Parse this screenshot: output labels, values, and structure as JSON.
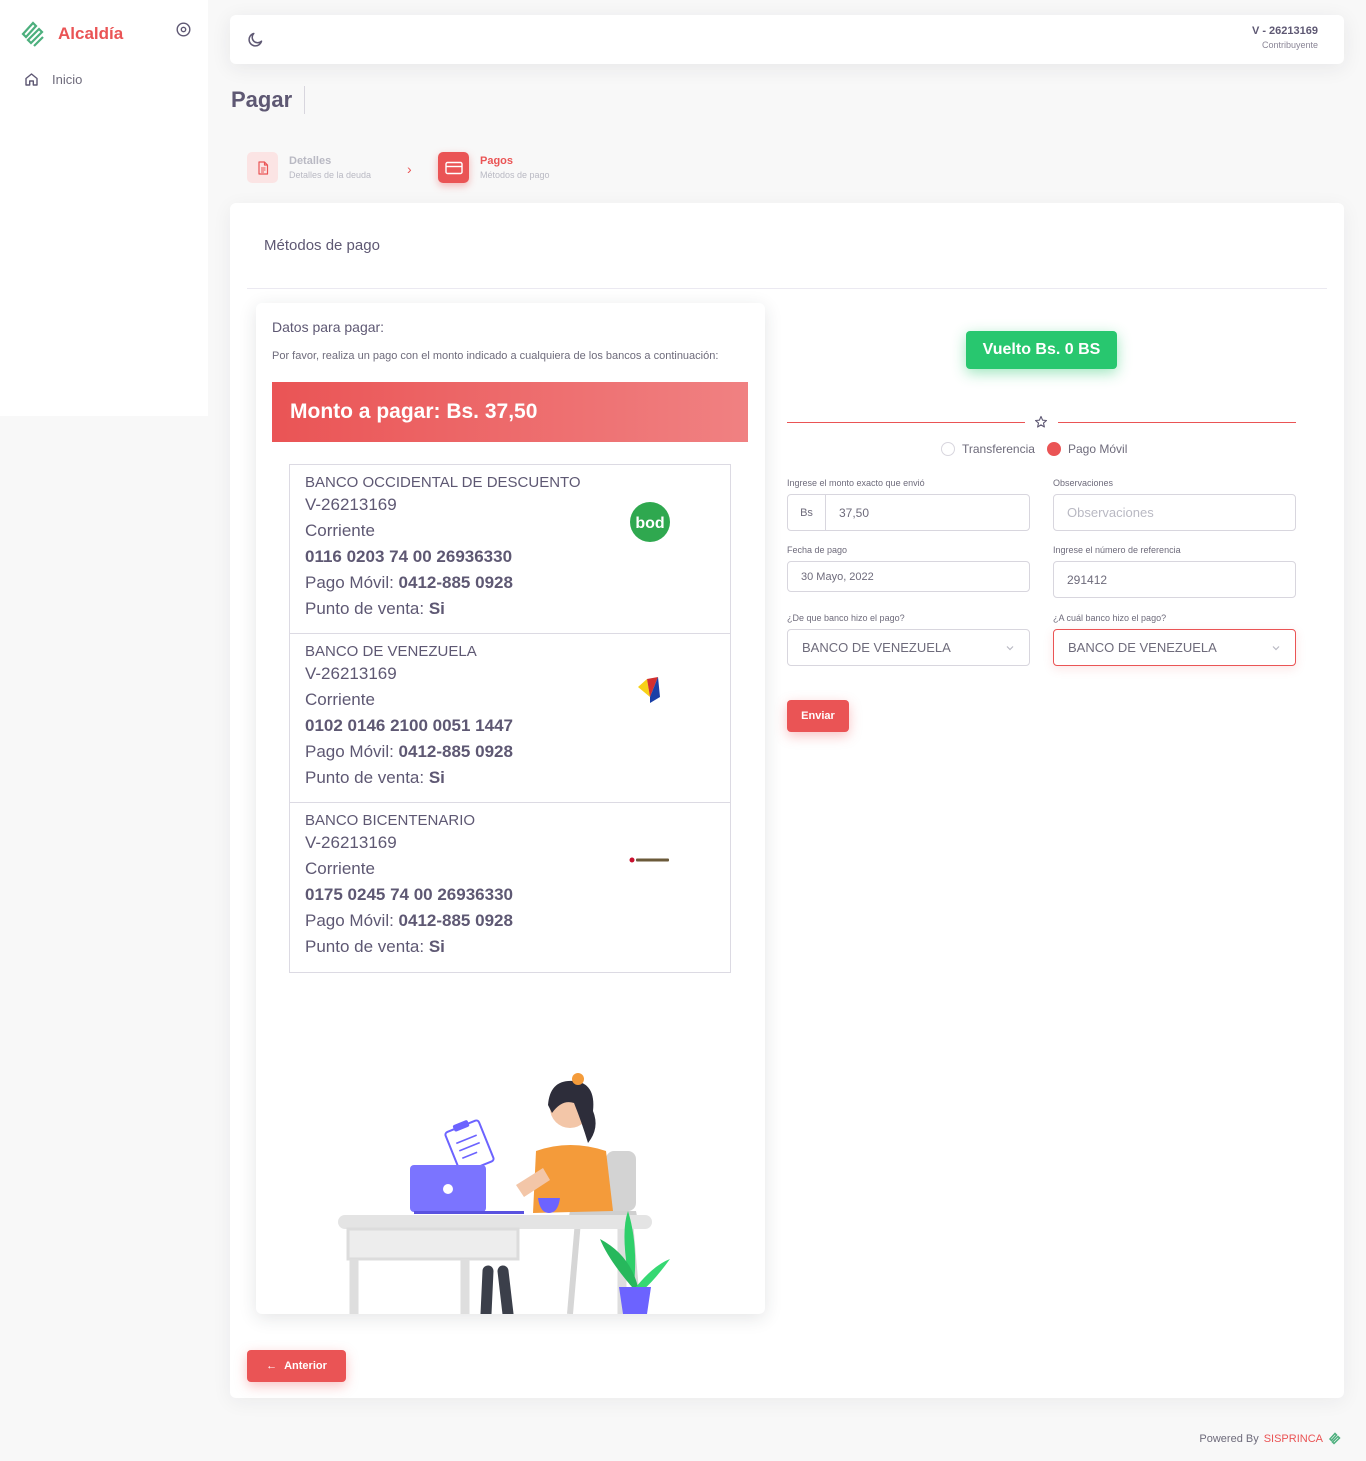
{
  "sidebar": {
    "brand": "Alcaldía",
    "items": [
      {
        "label": "Inicio",
        "icon": "home-icon"
      }
    ]
  },
  "navbar": {
    "user_id": "V - 26213169",
    "user_role": "Contribuyente"
  },
  "page": {
    "title": "Pagar"
  },
  "stepper": [
    {
      "title": "Detalles",
      "subtitle": "Detalles de la deuda",
      "state": "completed"
    },
    {
      "title": "Pagos",
      "subtitle": "Métodos de pago",
      "state": "active"
    }
  ],
  "card": {
    "header": "Métodos de pago"
  },
  "left": {
    "title": "Datos para pagar:",
    "description": "Por favor, realiza un pago con el monto indicado a cualquiera de los bancos a continuación:",
    "amount": "Monto a pagar: Bs. 37,50",
    "banks": [
      {
        "name": "BANCO OCCIDENTAL DE DESCUENTO",
        "rif": "V-26213169",
        "type": "Corriente",
        "account": "0116 0203 74 00 26936330",
        "pm_label": "Pago Móvil: ",
        "pm_value": "0412-885 0928",
        "pos_label": "Punto de venta: ",
        "pos_value": "Si",
        "logo": "bod-logo"
      },
      {
        "name": "BANCO DE VENEZUELA",
        "rif": "V-26213169",
        "type": "Corriente",
        "account": "0102 0146 2100 0051 1447",
        "pm_label": "Pago Móvil: ",
        "pm_value": "0412-885 0928",
        "pos_label": "Punto de venta: ",
        "pos_value": "Si",
        "logo": "bdv-logo"
      },
      {
        "name": "BANCO BICENTENARIO",
        "rif": "V-26213169",
        "type": "Corriente",
        "account": "0175 0245 74 00 26936330",
        "pm_label": "Pago Móvil: ",
        "pm_value": "0412-885 0928",
        "pos_label": "Punto de venta: ",
        "pos_value": "Si",
        "logo": "bicentenario-logo"
      }
    ]
  },
  "right": {
    "change": "Vuelto Bs. 0 BS",
    "radio_transfer": "Transferencia",
    "radio_mobile": "Pago Móvil",
    "selected_method": "Pago Móvil",
    "amount_label": "Ingrese el monto exacto que envió",
    "amount_prefix": "Bs",
    "amount_value": "37,50",
    "obs_label": "Observaciones",
    "obs_placeholder": "Observaciones",
    "date_label": "Fecha de pago",
    "date_value": "30 Mayo, 2022",
    "ref_label": "Ingrese el número de referencia",
    "ref_value": "291412",
    "from_bank_label": "¿De que banco hizo el pago?",
    "from_bank_value": "BANCO DE VENEZUELA",
    "to_bank_label": "¿A cuál banco hizo el pago?",
    "to_bank_value": "BANCO DE VENEZUELA",
    "submit": "Enviar"
  },
  "actions": {
    "back": "Anterior"
  },
  "footer": {
    "powered": "Powered By",
    "brand": "SISPRINCA"
  },
  "colors": {
    "accent": "#ea5455",
    "success": "#28c76f",
    "brand_logo": "#4caf7d"
  }
}
